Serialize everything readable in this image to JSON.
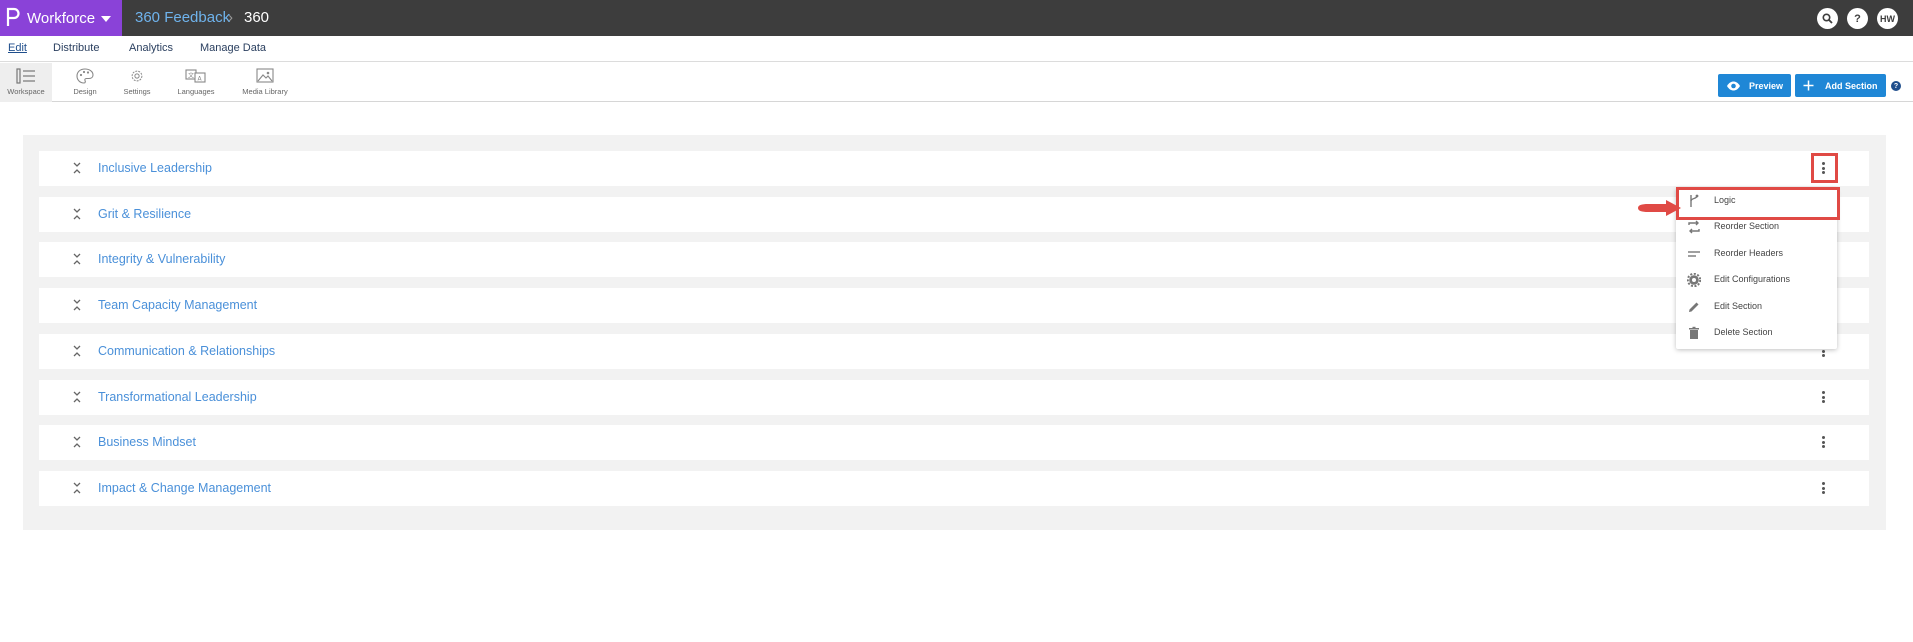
{
  "header": {
    "brand": "Workforce",
    "breadcrumb_project": "360 Feedback",
    "breadcrumb_separator": "›",
    "breadcrumb_current": "360",
    "avatar_initials": "HW"
  },
  "menu": {
    "tabs": [
      {
        "label": "Edit",
        "active": true
      },
      {
        "label": "Distribute",
        "active": false
      },
      {
        "label": "Analytics",
        "active": false
      },
      {
        "label": "Manage Data",
        "active": false
      }
    ]
  },
  "toolbar": {
    "tools": [
      {
        "label": "Workspace",
        "icon": "workspace-icon",
        "active": true
      },
      {
        "label": "Design",
        "icon": "palette-icon",
        "active": false
      },
      {
        "label": "Settings",
        "icon": "gear-icon",
        "active": false
      },
      {
        "label": "Languages",
        "icon": "translate-icon",
        "active": false
      },
      {
        "label": "Media Library",
        "icon": "image-icon",
        "active": false
      }
    ],
    "preview_label": "Preview",
    "add_section_label": "Add Section"
  },
  "sections": [
    "Inclusive Leadership",
    "Grit & Resilience",
    "Integrity & Vulnerability",
    "Team Capacity Management",
    "Communication & Relationships",
    "Transformational Leadership",
    "Business Mindset",
    "Impact & Change Management"
  ],
  "section_menu": {
    "items": [
      {
        "label": "Logic",
        "icon": "logic-branch-icon"
      },
      {
        "label": "Reorder Section",
        "icon": "reorder-icon"
      },
      {
        "label": "Reorder Headers",
        "icon": "lines-icon"
      },
      {
        "label": "Edit Configurations",
        "icon": "gear-icon"
      },
      {
        "label": "Edit Section",
        "icon": "pencil-icon"
      },
      {
        "label": "Delete Section",
        "icon": "trash-icon"
      }
    ]
  },
  "colors": {
    "brand": "#8a42d8",
    "topbar": "#3d3d3d",
    "primary_button": "#1f87d6",
    "section_title": "#4a90d9",
    "annotation": "#e04a45"
  }
}
